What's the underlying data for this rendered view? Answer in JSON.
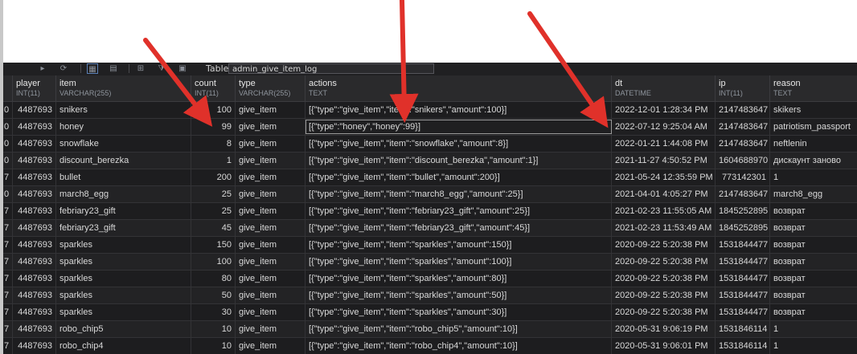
{
  "toolbar": {
    "table_label": "Table",
    "table_value": "admin_give_item_log",
    "icons": [
      "nav-icon",
      "grid-view-icon",
      "form-view-icon",
      "table-icon",
      "filter-icon",
      "export-icon"
    ]
  },
  "columns": [
    {
      "name": "player",
      "type": "INT(11)"
    },
    {
      "name": "item",
      "type": "VARCHAR(255)"
    },
    {
      "name": "count",
      "type": "INT(11)"
    },
    {
      "name": "type",
      "type": "VARCHAR(255)"
    },
    {
      "name": "actions",
      "type": "TEXT"
    },
    {
      "name": "dt",
      "type": "DATETIME"
    },
    {
      "name": "ip",
      "type": "INT(11)"
    },
    {
      "name": "reason",
      "type": "TEXT"
    }
  ],
  "rows": [
    {
      "id": "0",
      "player": "4487693",
      "item": "snikers",
      "count": "100",
      "type": "give_item",
      "actions": "[{\"type\":\"give_item\",\"item\":\"snikers\",\"amount\":100}]",
      "dt": "2022-12-01 1:28:34 PM",
      "ip": "2147483647",
      "reason": "skikers"
    },
    {
      "id": "0",
      "player": "4487693",
      "item": "honey",
      "count": "99",
      "type": "give_item",
      "actions": "[{\"type\":\"honey\",\"honey\":99}]",
      "dt": "2022-07-12 9:25:04 AM",
      "ip": "2147483647",
      "reason": "patriotism_passport"
    },
    {
      "id": "0",
      "player": "4487693",
      "item": "snowflake",
      "count": "8",
      "type": "give_item",
      "actions": "[{\"type\":\"give_item\",\"item\":\"snowflake\",\"amount\":8}]",
      "dt": "2022-01-21 1:44:08 PM",
      "ip": "2147483647",
      "reason": "neftlenin"
    },
    {
      "id": "0",
      "player": "4487693",
      "item": "discount_berezka",
      "count": "1",
      "type": "give_item",
      "actions": "[{\"type\":\"give_item\",\"item\":\"discount_berezka\",\"amount\":1}]",
      "dt": "2021-11-27 4:50:52 PM",
      "ip": "1604688970",
      "reason": "дискаунт заново"
    },
    {
      "id": "7",
      "player": "4487693",
      "item": "bullet",
      "count": "200",
      "type": "give_item",
      "actions": "[{\"type\":\"give_item\",\"item\":\"bullet\",\"amount\":200}]",
      "dt": "2021-05-24 12:35:59 PM",
      "ip": "773142301",
      "reason": "1"
    },
    {
      "id": "0",
      "player": "4487693",
      "item": "march8_egg",
      "count": "25",
      "type": "give_item",
      "actions": "[{\"type\":\"give_item\",\"item\":\"march8_egg\",\"amount\":25}]",
      "dt": "2021-04-01 4:05:27 PM",
      "ip": "2147483647",
      "reason": "march8_egg"
    },
    {
      "id": "7",
      "player": "4487693",
      "item": "febriary23_gift",
      "count": "25",
      "type": "give_item",
      "actions": "[{\"type\":\"give_item\",\"item\":\"febriary23_gift\",\"amount\":25}]",
      "dt": "2021-02-23 11:55:05 AM",
      "ip": "1845252895",
      "reason": "возврат"
    },
    {
      "id": "7",
      "player": "4487693",
      "item": "febriary23_gift",
      "count": "45",
      "type": "give_item",
      "actions": "[{\"type\":\"give_item\",\"item\":\"febriary23_gift\",\"amount\":45}]",
      "dt": "2021-02-23 11:53:49 AM",
      "ip": "1845252895",
      "reason": "возврат"
    },
    {
      "id": "7",
      "player": "4487693",
      "item": "sparkles",
      "count": "150",
      "type": "give_item",
      "actions": "[{\"type\":\"give_item\",\"item\":\"sparkles\",\"amount\":150}]",
      "dt": "2020-09-22 5:20:38 PM",
      "ip": "1531844477",
      "reason": "возврат"
    },
    {
      "id": "7",
      "player": "4487693",
      "item": "sparkles",
      "count": "100",
      "type": "give_item",
      "actions": "[{\"type\":\"give_item\",\"item\":\"sparkles\",\"amount\":100}]",
      "dt": "2020-09-22 5:20:38 PM",
      "ip": "1531844477",
      "reason": "возврат"
    },
    {
      "id": "7",
      "player": "4487693",
      "item": "sparkles",
      "count": "80",
      "type": "give_item",
      "actions": "[{\"type\":\"give_item\",\"item\":\"sparkles\",\"amount\":80}]",
      "dt": "2020-09-22 5:20:38 PM",
      "ip": "1531844477",
      "reason": "возврат"
    },
    {
      "id": "7",
      "player": "4487693",
      "item": "sparkles",
      "count": "50",
      "type": "give_item",
      "actions": "[{\"type\":\"give_item\",\"item\":\"sparkles\",\"amount\":50}]",
      "dt": "2020-09-22 5:20:38 PM",
      "ip": "1531844477",
      "reason": "возврат"
    },
    {
      "id": "7",
      "player": "4487693",
      "item": "sparkles",
      "count": "30",
      "type": "give_item",
      "actions": "[{\"type\":\"give_item\",\"item\":\"sparkles\",\"amount\":30}]",
      "dt": "2020-09-22 5:20:38 PM",
      "ip": "1531844477",
      "reason": "возврат"
    },
    {
      "id": "7",
      "player": "4487693",
      "item": "robo_chip5",
      "count": "10",
      "type": "give_item",
      "actions": "[{\"type\":\"give_item\",\"item\":\"robo_chip5\",\"amount\":10}]",
      "dt": "2020-05-31 9:06:19 PM",
      "ip": "1531846114",
      "reason": "1"
    },
    {
      "id": "7",
      "player": "4487693",
      "item": "robo_chip4",
      "count": "10",
      "type": "give_item",
      "actions": "[{\"type\":\"give_item\",\"item\":\"robo_chip4\",\"amount\":10}]",
      "dt": "2020-05-31 9:06:01 PM",
      "ip": "1531846114",
      "reason": "1"
    }
  ],
  "annotation": {
    "arrow_color": "#e0312a"
  }
}
